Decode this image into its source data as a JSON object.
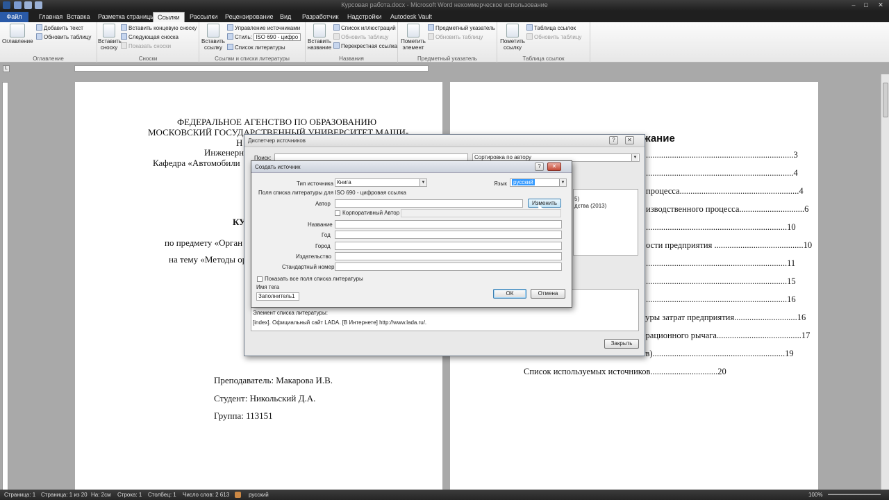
{
  "window": {
    "title": "Курсовая работа.docx - Microsoft Word некоммерческое использование"
  },
  "tabs": [
    {
      "label": "Файл"
    },
    {
      "label": "Главная"
    },
    {
      "label": "Вставка"
    },
    {
      "label": "Разметка страницы"
    },
    {
      "label": "Ссылки"
    },
    {
      "label": "Рассылки"
    },
    {
      "label": "Рецензирование"
    },
    {
      "label": "Вид"
    },
    {
      "label": "Разработчик"
    },
    {
      "label": "Надстройки"
    },
    {
      "label": "Autodesk Vault"
    }
  ],
  "ribbon": {
    "toc": {
      "group": "Оглавление",
      "toc_button": "Оглавление",
      "add_text": "Добавить текст",
      "update_table": "Обновить таблицу"
    },
    "footnotes": {
      "group": "Сноски",
      "insert_footnote_1": "Вставить",
      "insert_footnote_2": "сноску",
      "insert_endnote": "Вставить концевую сноску",
      "next_footnote": "Следующая сноска",
      "show_notes": "Показать сноски"
    },
    "citations": {
      "group": "Ссылки и списки литературы",
      "insert_citation_1": "Вставить",
      "insert_citation_2": "ссылку",
      "manage_sources": "Управление источниками",
      "style_label": "Стиль:",
      "style_value": "ISO 690 - цифро",
      "bibliography": "Список литературы"
    },
    "captions": {
      "group": "Названия",
      "insert_caption_1": "Вставить",
      "insert_caption_2": "название",
      "list_of_figures": "Список иллюстраций",
      "update_table": "Обновить таблицу",
      "cross_reference": "Перекрестная ссылка"
    },
    "index": {
      "group": "Предметный указатель",
      "mark_entry_1": "Пометить",
      "mark_entry_2": "элемент",
      "insert_index": "Предметный указатель",
      "update_index": "Обновить таблицу"
    },
    "authorities": {
      "group": "Таблица ссылок",
      "mark_citation_1": "Пометить",
      "mark_citation_2": "ссылку",
      "table_of_authorities": "Таблица ссылок",
      "update_table": "Обновить таблицу"
    }
  },
  "page_left": {
    "line1": "ФЕДЕРАЛЬНОЕ АГЕНСТВО ПО ОБРАЗОВАНИЮ",
    "line2": "МОСКОВСКИЙ ГОСУДАРСТВЕННЫЙ УНИВЕРСИТЕТ МАШИ-",
    "line3": "Н",
    "line4": "Инженерн",
    "line5": "Кафедра «Автомобили",
    "line6": "КУ",
    "line7": "по предмету «Орган",
    "line8": "на тему «Методы ор",
    "teacher": "Преподаватель: Макарова И.В.",
    "student": "Студент: Никольский Д.А.",
    "group": "Группа: 113151"
  },
  "page_right": {
    "heading": "жание",
    "toc": [
      {
        "text": "....................................................................3"
      },
      {
        "text": "....................................................................4"
      },
      {
        "text": "процесса.......................................................4"
      },
      {
        "text": "изводственного процесса..............................6"
      },
      {
        "text": ".................................................................10"
      },
      {
        "text": "ости предприятия .........................................10"
      },
      {
        "text": ".................................................................11"
      },
      {
        "text": ".................................................................15"
      },
      {
        "text": ".................................................................16"
      },
      {
        "text": "туры затрат предприятия.............................16"
      },
      {
        "text": "ерационного рычага.......................................17"
      },
      {
        "text": "тв).............................................................19"
      },
      {
        "text": "Список используемых источников...............................20"
      }
    ]
  },
  "source_manager": {
    "title": "Диспетчер источников",
    "search_label": "Поиск:",
    "sort_value": "Сортировка по автору",
    "list_fragment_1": "5)",
    "list_fragment_2": "дства (2013)",
    "preview_title": "Элемент списка литературы:",
    "preview_text": "[index]. Официальный сайт LADA. [В Интернете] http://www.lada.ru/.",
    "close_button": "Закрыть",
    "help_button": "?",
    "close_x": "✕"
  },
  "create_source": {
    "title": "Создать источник",
    "source_type_label": "Тип источника",
    "source_type_value": "Книга",
    "language_label": "Язык",
    "language_value": "русский",
    "fields_header": "Поля списка литературы для ISO 690 - цифровая ссылка",
    "author_label": "Автор",
    "edit_button": "Изменить",
    "corporate_author": "Корпоративный Автор",
    "title_label": "Название",
    "year_label": "Год",
    "city_label": "Город",
    "publisher_label": "Издательство",
    "standard_number_label": "Стандартный номер",
    "show_all_fields": "Показать все поля списка литературы",
    "tag_name_label": "Имя тега",
    "tag_name_value": "Заполнитель1",
    "ok_button": "ОК",
    "cancel_button": "Отмена",
    "help_button": "?",
    "close_x": "✕"
  },
  "statusbar": {
    "page": "Страница: 1",
    "page_of": "Страница: 1 из 20",
    "at": "На: 2см",
    "line": "Строка: 1",
    "column": "Столбец: 1",
    "words": "Число слов: 2 613",
    "language": "русский",
    "zoom": "100%"
  },
  "colors": {
    "file_tab": "#2a5aa8",
    "dialog_selection": "#3399ff"
  }
}
